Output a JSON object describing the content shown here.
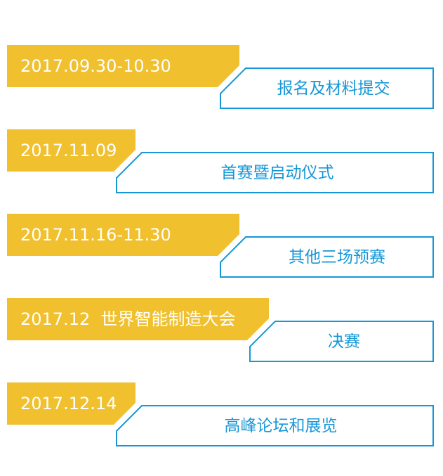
{
  "colors": {
    "date_band": "#f0c02e",
    "event_border": "#1797d7",
    "event_text": "#1797d7",
    "date_text": "#ffffff"
  },
  "timeline": [
    {
      "date": "2017.09.30-10.30",
      "event": "报名及材料提交"
    },
    {
      "date": "2017.11.09",
      "event": "首赛暨启动仪式"
    },
    {
      "date": "2017.11.16-11.30",
      "event": "其他三场预赛"
    },
    {
      "date": "2017.12  世界智能制造大会",
      "event": "决赛"
    },
    {
      "date": "2017.12.14",
      "event": "高峰论坛和展览"
    }
  ]
}
